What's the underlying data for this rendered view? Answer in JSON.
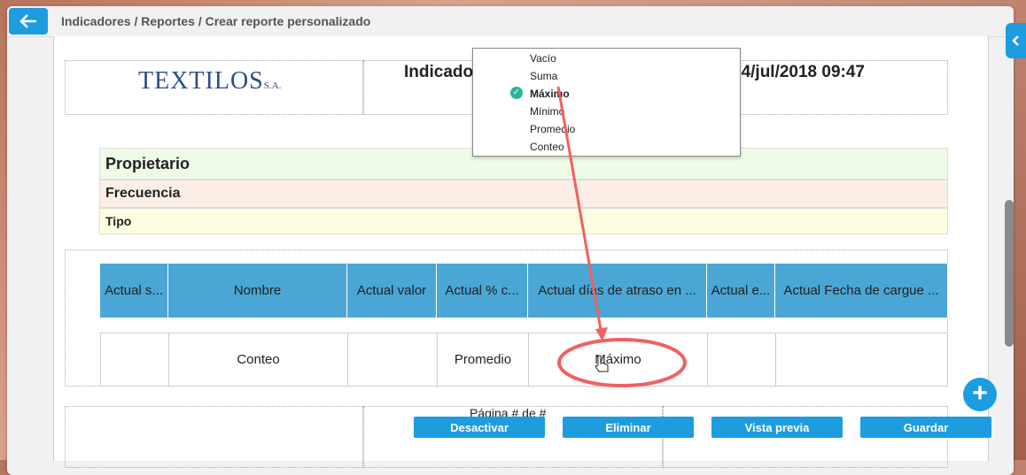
{
  "breadcrumb": "Indicadores / Reportes / Crear reporte personalizado",
  "logo": {
    "name": "TEXTILOS",
    "suffix": "S.A."
  },
  "header": {
    "title": "Indicado",
    "date": "24/jul/2018 09:47"
  },
  "info": {
    "owner": "Propietario",
    "frequency": "Frecuencia",
    "type": "Tipo"
  },
  "table": {
    "headers": [
      "Actual s...",
      "Nombre",
      "Actual valor",
      "Actual % c...",
      "Actual días de atraso en ...",
      "Actual e...",
      "Actual Fecha de cargue ..."
    ],
    "cells": [
      "",
      "Conteo",
      "",
      "Promedio",
      "Máximo",
      "",
      ""
    ]
  },
  "dropdown": {
    "options": [
      "Vacío",
      "Suma",
      "Máximo",
      "Mínimo",
      "Promedio",
      "Conteo"
    ],
    "selected": "Máximo"
  },
  "footer": {
    "page_text": "Página # de #"
  },
  "buttons": {
    "deactivate": "Desactivar",
    "delete": "Eliminar",
    "preview": "Vista previa",
    "save": "Guardar"
  },
  "colors": {
    "accent": "#1e9ce0",
    "table_header": "#4aa6d5",
    "owner_bg": "#eefbe6",
    "frequency_bg": "#fbeee6",
    "type_bg": "#fdfde2",
    "annotation": "#f06060"
  },
  "icons": {
    "back": "arrow-left-icon",
    "check": "check-circle-icon",
    "add": "plus-icon",
    "collapse": "chevron-left-icon",
    "cursor": "hand-cursor-icon"
  }
}
